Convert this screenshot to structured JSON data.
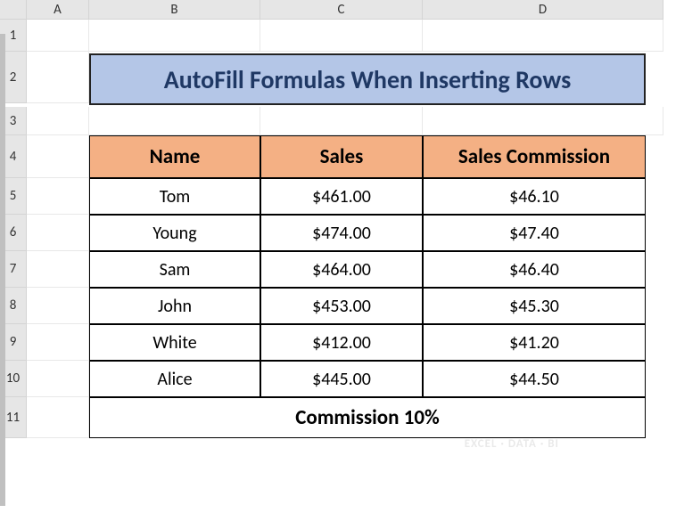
{
  "columns": [
    "A",
    "B",
    "C",
    "D"
  ],
  "rows": [
    "1",
    "2",
    "3",
    "4",
    "5",
    "6",
    "7",
    "8",
    "9",
    "10",
    "11"
  ],
  "title": "AutoFill Formulas When Inserting Rows",
  "headers": {
    "name": "Name",
    "sales": "Sales",
    "commission": "Sales Commission"
  },
  "data": [
    {
      "name": "Tom",
      "sales": "$461.00",
      "commission": "$46.10"
    },
    {
      "name": "Young",
      "sales": "$474.00",
      "commission": "$47.40"
    },
    {
      "name": "Sam",
      "sales": "$464.00",
      "commission": "$46.40"
    },
    {
      "name": "John",
      "sales": "$453.00",
      "commission": "$45.30"
    },
    {
      "name": "White",
      "sales": "$412.00",
      "commission": "$41.20"
    },
    {
      "name": "Alice",
      "sales": "$445.00",
      "commission": "$44.50"
    }
  ],
  "footer": "Commission 10%",
  "watermark": "EXCEL · DATA · BI"
}
